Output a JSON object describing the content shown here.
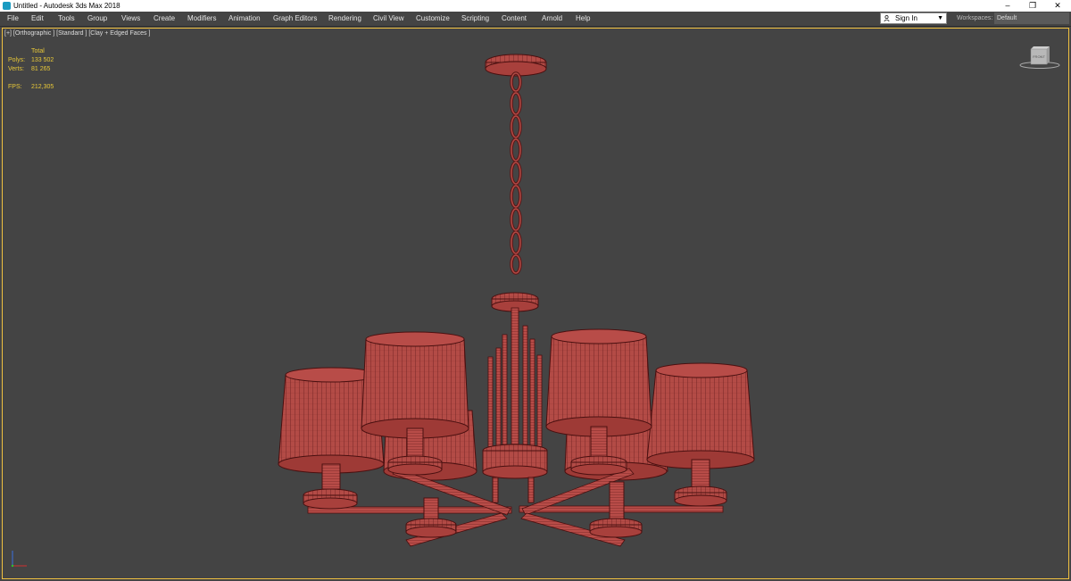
{
  "window": {
    "title": "Untitled - Autodesk 3ds Max 2018",
    "minimize": "–",
    "restore": "❐",
    "close": "✕"
  },
  "menu": [
    "File",
    "Edit",
    "Tools",
    "Group",
    "Views",
    "Create",
    "Modifiers",
    "Animation",
    "Graph Editors",
    "Rendering",
    "Civil View",
    "Customize",
    "Scripting",
    "Content",
    "Arnold",
    "Help"
  ],
  "account": {
    "sign_in_label": "Sign In",
    "dropdown_arrow": "▼"
  },
  "workspaces": {
    "label": "Workspaces:",
    "value": "Default"
  },
  "viewport": {
    "label": "[+] [Orthographic ] [Standard ] [Clay + Edged Faces ]",
    "stats": {
      "header": "Total",
      "polys_label": "Polys:",
      "polys_value": "133 502",
      "verts_label": "Verts:",
      "verts_value": "81 265",
      "fps_label": "FPS:",
      "fps_value": "212,305"
    },
    "viewcube_label": "FRONT"
  },
  "colors": {
    "accent": "#f0c040",
    "model_fill": "#b64c48",
    "model_wire": "#5a1616",
    "viewport_bg": "#444444"
  }
}
